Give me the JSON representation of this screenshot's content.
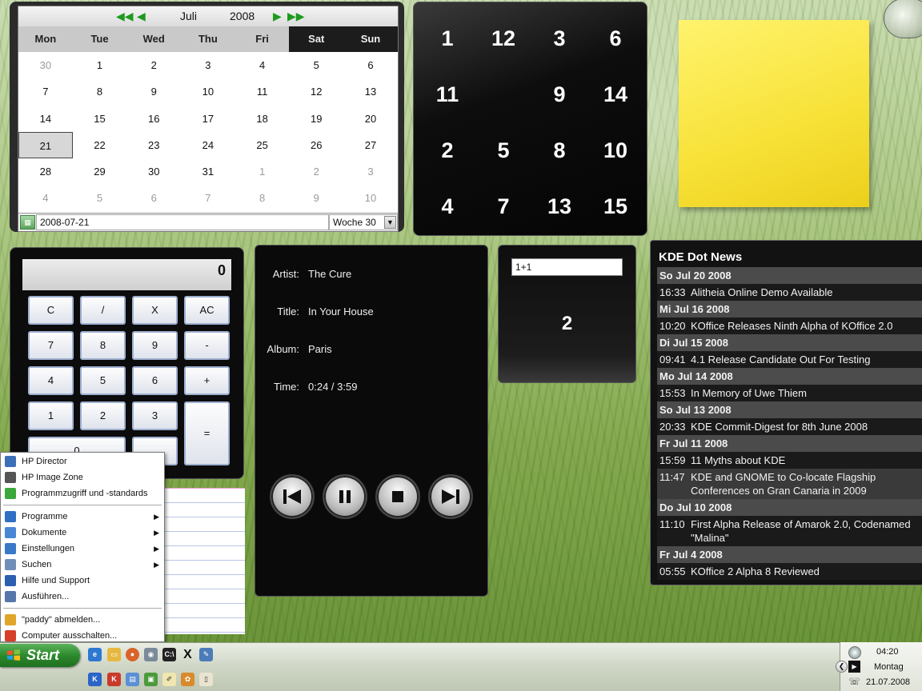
{
  "calendar": {
    "month": "Juli",
    "year": "2008",
    "weekdays": [
      "Mon",
      "Tue",
      "Wed",
      "Thu",
      "Fri",
      "Sat",
      "Sun"
    ],
    "weeks": [
      [
        "30",
        "1",
        "2",
        "3",
        "4",
        "5",
        "6"
      ],
      [
        "7",
        "8",
        "9",
        "10",
        "11",
        "12",
        "13"
      ],
      [
        "14",
        "15",
        "16",
        "17",
        "18",
        "19",
        "20"
      ],
      [
        "21",
        "22",
        "23",
        "24",
        "25",
        "26",
        "27"
      ],
      [
        "28",
        "29",
        "30",
        "31",
        "1",
        "2",
        "3"
      ],
      [
        "4",
        "5",
        "6",
        "7",
        "8",
        "9",
        "10"
      ]
    ],
    "selected_date": "2008-07-21",
    "week_label": "Woche 30"
  },
  "puzzle": {
    "tiles": [
      "1",
      "12",
      "3",
      "6",
      "11",
      "",
      "9",
      "14",
      "2",
      "5",
      "8",
      "10",
      "4",
      "7",
      "13",
      "15"
    ]
  },
  "calculator": {
    "display": "0",
    "buttons": [
      "C",
      "/",
      "X",
      "AC",
      "7",
      "8",
      "9",
      "-",
      "4",
      "5",
      "6",
      "+",
      "1",
      "2",
      "3",
      "=",
      "0",
      ""
    ]
  },
  "player": {
    "artist_label": "Artist:",
    "artist": "The Cure",
    "title_label": "Title:",
    "title": "In Your House",
    "album_label": "Album:",
    "album": "Paris",
    "time_label": "Time:",
    "time": "0:24 / 3:59"
  },
  "calc2": {
    "expression": "1+1",
    "result": "2"
  },
  "news": {
    "title": "KDE Dot News",
    "rows": [
      {
        "kind": "date",
        "text": "So Jul 20 2008"
      },
      {
        "kind": "item",
        "time": "16:33",
        "text": "Alitheia Online Demo Available"
      },
      {
        "kind": "date",
        "text": "Mi Jul 16 2008"
      },
      {
        "kind": "item",
        "time": "10:20",
        "text": "KOffice Releases Ninth Alpha of KOffice 2.0"
      },
      {
        "kind": "date",
        "text": "Di Jul 15 2008"
      },
      {
        "kind": "item",
        "time": "09:41",
        "text": "4.1 Release Candidate Out For Testing"
      },
      {
        "kind": "date",
        "text": "Mo Jul 14 2008"
      },
      {
        "kind": "item",
        "time": "15:53",
        "text": "In Memory of Uwe Thiem"
      },
      {
        "kind": "date",
        "text": "So Jul 13 2008"
      },
      {
        "kind": "item",
        "time": "20:33",
        "text": "KDE Commit-Digest for 8th June 2008"
      },
      {
        "kind": "date",
        "text": "Fr Jul 11 2008"
      },
      {
        "kind": "item",
        "time": "15:59",
        "text": "11 Myths about KDE"
      },
      {
        "kind": "item",
        "time": "11:47",
        "text": "KDE and GNOME to Co-locate Flagship Conferences on Gran Canaria in 2009"
      },
      {
        "kind": "date",
        "text": "Do Jul 10 2008"
      },
      {
        "kind": "item",
        "time": "11:10",
        "text": "First Alpha Release of Amarok 2.0, Codenamed \"Malina\""
      },
      {
        "kind": "date",
        "text": "Fr Jul 4 2008"
      },
      {
        "kind": "item",
        "time": "05:55",
        "text": "KOffice 2 Alpha 8 Reviewed"
      }
    ]
  },
  "start_menu": {
    "pinned": [
      {
        "label": "HP Director",
        "icon": "hp-director-icon",
        "color": "#3b6fb8"
      },
      {
        "label": "HP Image Zone",
        "icon": "hp-image-zone-icon",
        "color": "#555555"
      },
      {
        "label": "Programmzugriff und -standards",
        "icon": "program-defaults-icon",
        "color": "#3aa83a"
      }
    ],
    "items": [
      {
        "label": "Programme",
        "icon": "programs-icon",
        "color": "#2f6fc4",
        "submenu": true
      },
      {
        "label": "Dokumente",
        "icon": "documents-icon",
        "color": "#4a86d6",
        "submenu": true
      },
      {
        "label": "Einstellungen",
        "icon": "settings-icon",
        "color": "#3a78c8",
        "submenu": true
      },
      {
        "label": "Suchen",
        "icon": "search-icon",
        "color": "#6f8fb8",
        "submenu": true
      },
      {
        "label": "Hilfe und Support",
        "icon": "help-icon",
        "color": "#2c5fb0",
        "submenu": false
      },
      {
        "label": "Ausführen...",
        "icon": "run-icon",
        "color": "#5577aa",
        "submenu": false
      }
    ],
    "footer": [
      {
        "label": "\"paddy\" abmelden...",
        "icon": "logoff-icon",
        "color": "#e0a52a"
      },
      {
        "label": "Computer ausschalten...",
        "icon": "shutdown-icon",
        "color": "#d6402a"
      }
    ]
  },
  "taskbar": {
    "start_label": "Start",
    "tray_time": "04:20",
    "tray_day": "Montag",
    "tray_date": "21.07.2008"
  }
}
